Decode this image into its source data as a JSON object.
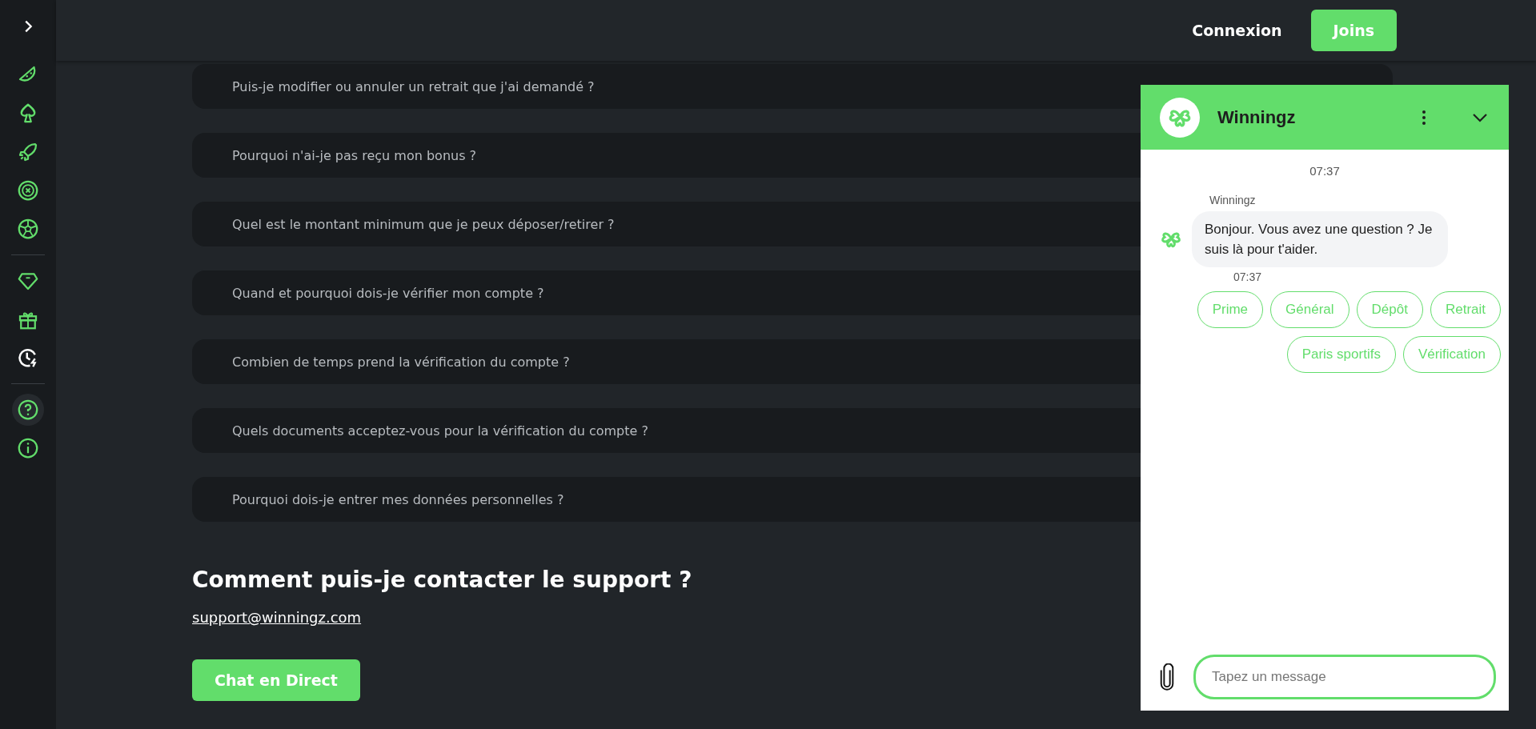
{
  "sidebar": {
    "items": [
      {
        "selected": false
      },
      {
        "selected": false
      },
      {
        "selected": false
      },
      {
        "selected": false
      },
      {
        "selected": false
      },
      {
        "selected": false
      },
      {
        "selected": false
      },
      {
        "selected": false
      },
      {
        "selected": true
      },
      {
        "selected": false
      }
    ]
  },
  "topbar": {
    "buttons": [
      {
        "label": "Connexion",
        "kind": "text"
      },
      {
        "label": "Joins",
        "kind": "primary"
      }
    ]
  },
  "faq": {
    "items": [
      "Puis-je modifier ou annuler un retrait que j'ai demandé ?",
      "Pourquoi n'ai-je pas reçu mon bonus ?",
      "Quel est le montant minimum que je peux déposer/retirer ?",
      "Quand et pourquoi dois-je vérifier mon compte ?",
      "Combien de temps prend la vérification du compte ?",
      "Quels documents acceptez-vous pour la vérification du compte ?",
      "Pourquoi dois-je entrer mes données personnelles ?"
    ]
  },
  "contact": {
    "heading": "Comment puis-je contacter le support ?",
    "email": "support@winningz.com",
    "button": "Chat en Direct"
  },
  "chat": {
    "title": "Winningz",
    "date_time": "07:37",
    "sender": "Winningz",
    "message": "Bonjour. Vous avez une question ? Je suis là pour t'aider.",
    "message_time": "07:37",
    "quick_replies": [
      "Prime",
      "Général",
      "Dépôt",
      "Retrait",
      "Paris sportifs",
      "Vérification"
    ],
    "input": {
      "placeholder": "Tapez un message"
    }
  }
}
